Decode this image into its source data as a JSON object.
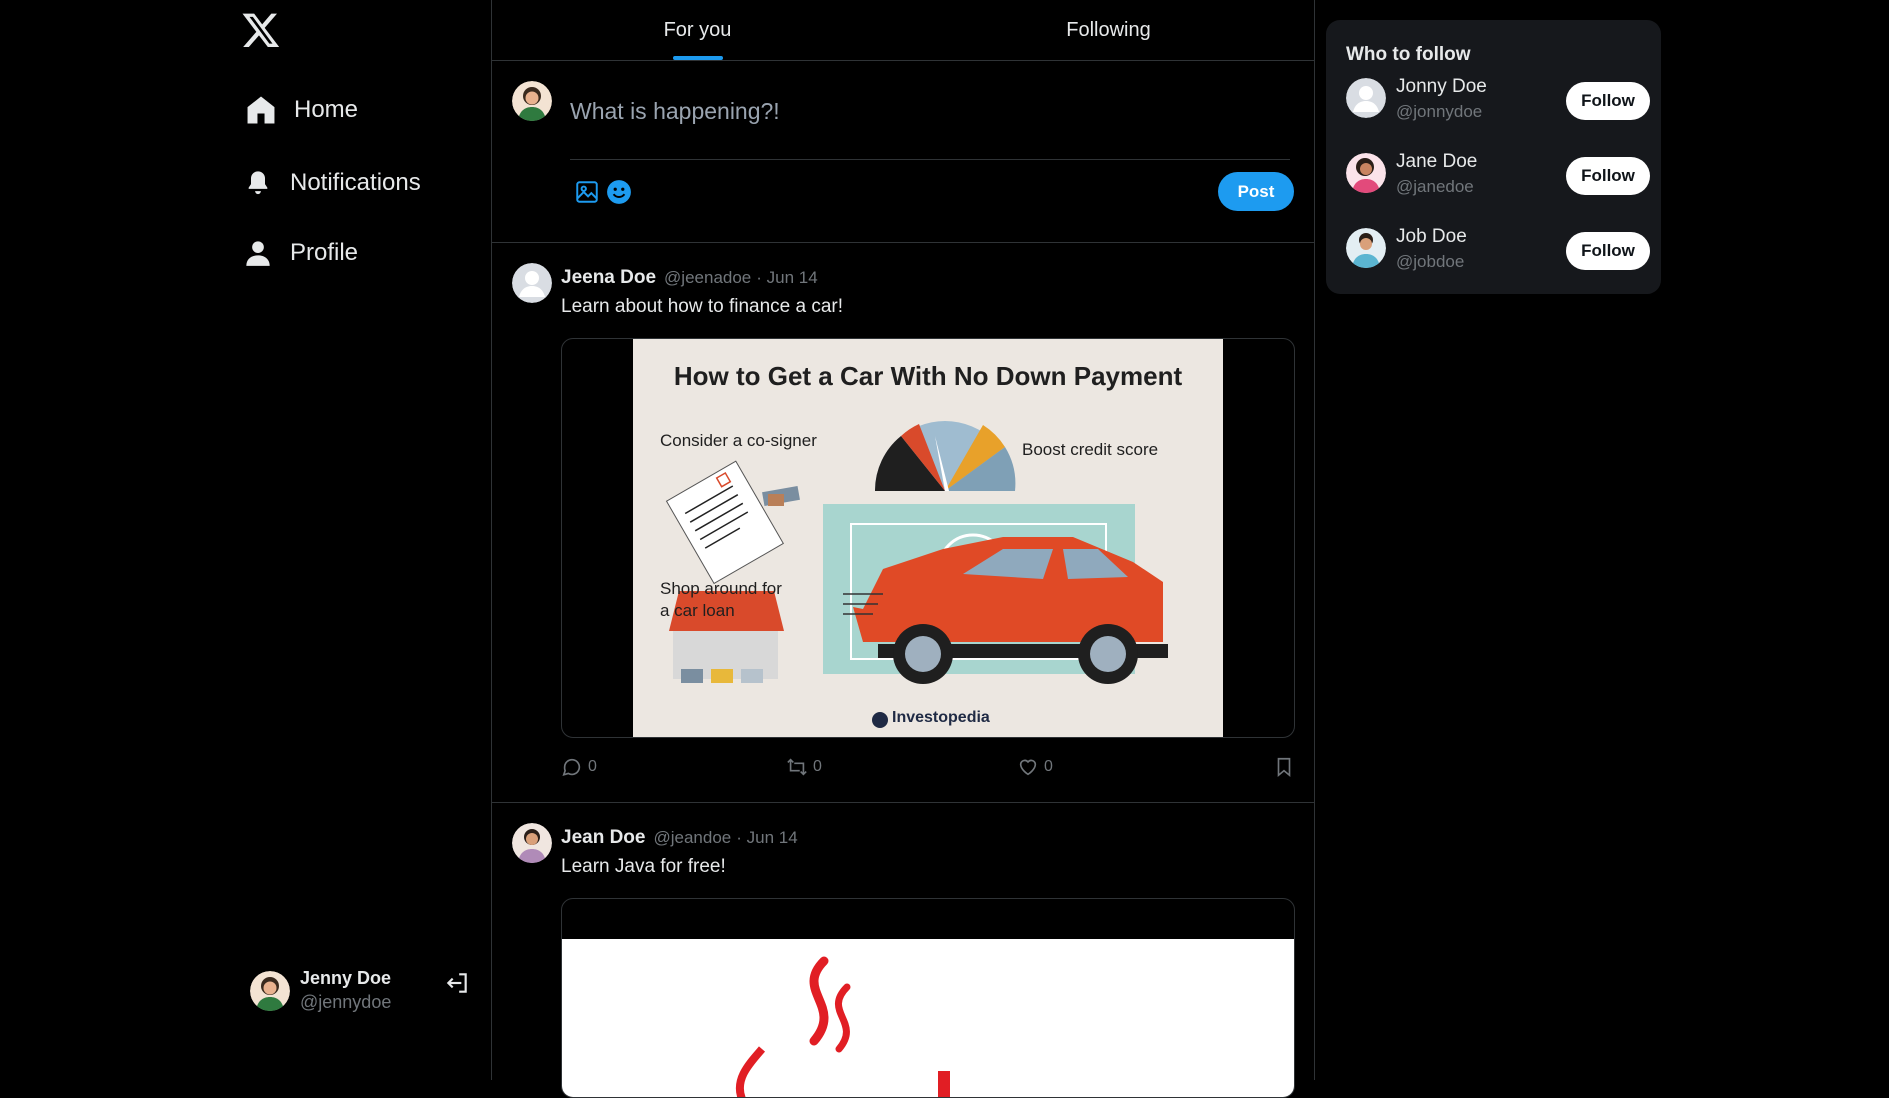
{
  "sidebar": {
    "nav": [
      {
        "label": "Home",
        "icon": "home-icon"
      },
      {
        "label": "Notifications",
        "icon": "bell-icon"
      },
      {
        "label": "Profile",
        "icon": "person-icon"
      }
    ],
    "current_user": {
      "name": "Jenny Doe",
      "handle": "@jennydoe"
    }
  },
  "tabs": [
    {
      "label": "For you",
      "active": true
    },
    {
      "label": "Following",
      "active": false
    }
  ],
  "compose": {
    "placeholder": "What is happening?!",
    "post_label": "Post"
  },
  "tweets": [
    {
      "name": "Jeena Doe",
      "handle": "@jeenadoe",
      "date": "· Jun 14",
      "text": "Learn about how to finance a car!",
      "media": {
        "title": "How to Get a Car With No Down Payment",
        "labels": [
          "Consider a co-signer",
          "Boost credit score",
          "Shop around for",
          "a car loan"
        ],
        "brand": "Investopedia"
      },
      "replies": "0",
      "retweets": "0",
      "likes": "0"
    },
    {
      "name": "Jean Doe",
      "handle": "@jeandoe",
      "date": "· Jun 14",
      "text": "Learn Java for free!"
    }
  ],
  "who_to_follow": {
    "title": "Who to follow",
    "users": [
      {
        "name": "Jonny Doe",
        "handle": "@jonnydoe",
        "button": "Follow"
      },
      {
        "name": "Jane Doe",
        "handle": "@janedoe",
        "button": "Follow"
      },
      {
        "name": "Job Doe",
        "handle": "@jobdoe",
        "button": "Follow"
      }
    ]
  },
  "colors": {
    "accent": "#1d9bf0",
    "background": "#000000",
    "border": "#2f3336",
    "muted": "#71767b"
  }
}
